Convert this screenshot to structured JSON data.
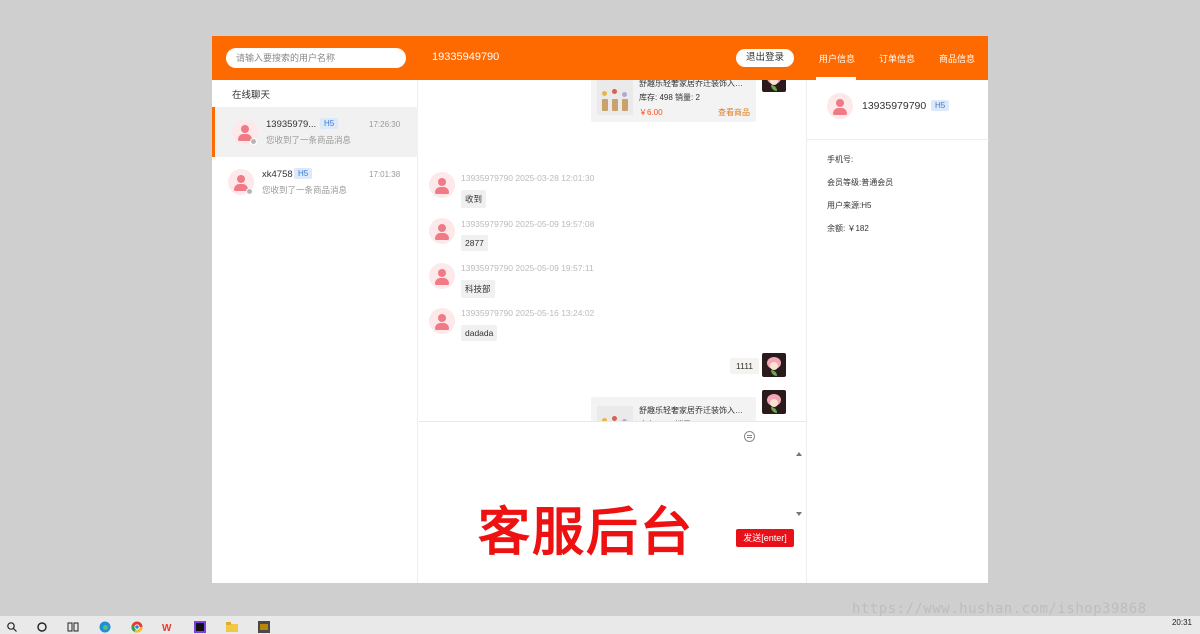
{
  "header": {
    "search_placeholder": "请输入要搜索的用户名称",
    "current_user": "19335949790",
    "logout_label": "退出登录",
    "tabs": [
      {
        "label": "用户信息"
      },
      {
        "label": "订单信息"
      },
      {
        "label": "商品信息"
      }
    ],
    "active_tab": "用户信息"
  },
  "sidebar": {
    "title": "在线聊天",
    "conversations": [
      {
        "name": "13935979...",
        "badge": "H5",
        "last_message": "您收到了一条商品消息",
        "time": "17:26:30"
      },
      {
        "name": "xk4758",
        "badge": "H5",
        "last_message": "您收到了一条商品消息",
        "time": "17:01:38"
      }
    ]
  },
  "chat": {
    "product_card": {
      "title": "舒趣乐轻奢家居乔迁装饰入户...",
      "stock_sales": "库存: 498 销量: 2",
      "price": "￥6.00",
      "view_label": "查看商品"
    },
    "messages": [
      {
        "meta": "13935979790 2025-03-28 12:01:30",
        "text": "收到"
      },
      {
        "meta": "13935979790 2025-05-09 19:57:08",
        "text": "2877"
      },
      {
        "meta": "13935979790 2025-05-09 19:57:11",
        "text": "科技部"
      },
      {
        "meta": "13935979790 2025-05-16 13:24:02",
        "text": "dadada"
      }
    ],
    "outgoing_text": "1111"
  },
  "input": {
    "overlay_text": "客服后台",
    "send_label": "发送[enter]"
  },
  "user_info": {
    "name": "13935979790",
    "badge": "H5",
    "phone_label": "手机号:",
    "level": "会员等级:普通会员",
    "source": "用户来源:H5",
    "balance": "余额: ￥182"
  },
  "taskbar": {
    "time": "20:31",
    "watermark": "https://www.hushan.com/ishop39868"
  },
  "colors": {
    "brand": "#ff6a00",
    "send": "#e8111a",
    "overlay": "#ee1111"
  }
}
